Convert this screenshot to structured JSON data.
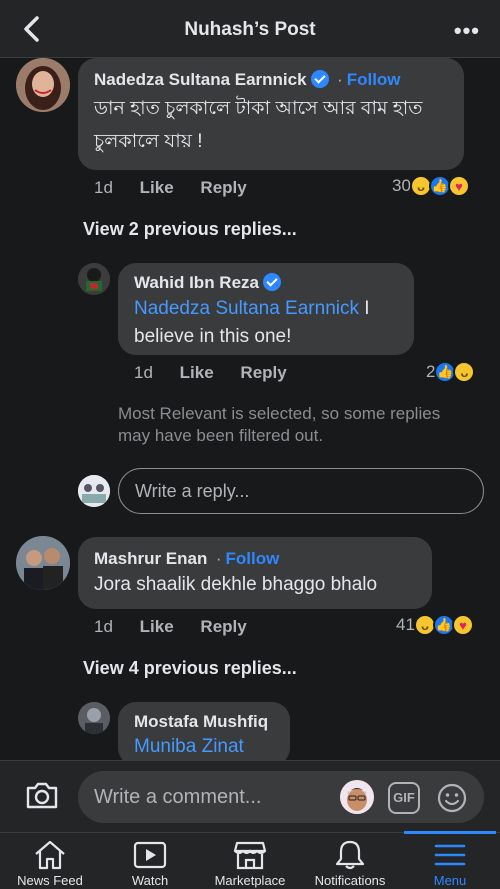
{
  "header": {
    "title": "Nuhash’s Post"
  },
  "comments": [
    {
      "author": "Nadedza Sultana Earnnick",
      "verified": true,
      "follow": "Follow",
      "text": "ডান হাত চুলকালে টাকা আসে আর বাম হাত চুলকালে যায় !",
      "text_line1": "ডান হাত চুলকালে টাকা আসে আর বাম হাত",
      "text_line2": "চুলকালে যায় !",
      "time": "1d",
      "like": "Like",
      "reply": "Reply",
      "reaction_count": "30",
      "reactions": [
        "haha-icon",
        "like-icon",
        "care-icon"
      ],
      "view_previous": "View 2 previous replies...",
      "replies": [
        {
          "author": "Wahid Ibn Reza",
          "verified": true,
          "mention": "Nadedza Sultana Earnnick",
          "text_after_mention": " I",
          "text_line2": "believe in this one!",
          "time": "1d",
          "like": "Like",
          "reply": "Reply",
          "reaction_count": "2",
          "reactions": [
            "like-icon",
            "haha-icon"
          ]
        }
      ],
      "filter_notice": "Most Relevant is selected, so some replies may have been filtered out.",
      "reply_placeholder": "Write a reply..."
    },
    {
      "author": "Mashrur Enan",
      "follow": "Follow",
      "text": "Jora shaalik dekhle bhaggo bhalo",
      "time": "1d",
      "like": "Like",
      "reply": "Reply",
      "reaction_count": "41",
      "reactions": [
        "haha-icon",
        "like-icon",
        "care-icon"
      ],
      "view_previous": "View 4 previous replies...",
      "replies": [
        {
          "author": "Mostafa Mushfiq",
          "mention": "Muniba Zinat"
        }
      ]
    }
  ],
  "composer": {
    "placeholder": "Write a comment...",
    "gif": "GIF"
  },
  "tabs": [
    {
      "label": "News Feed",
      "icon": "home-icon"
    },
    {
      "label": "Watch",
      "icon": "watch-icon"
    },
    {
      "label": "Marketplace",
      "icon": "marketplace-icon"
    },
    {
      "label": "Notifications",
      "icon": "bell-icon"
    },
    {
      "label": "Menu",
      "icon": "menu-icon",
      "active": true
    }
  ],
  "colors": {
    "background": "#18191a",
    "bubble": "#3a3b3c",
    "accent": "#2d88ff",
    "bar": "#242526"
  }
}
